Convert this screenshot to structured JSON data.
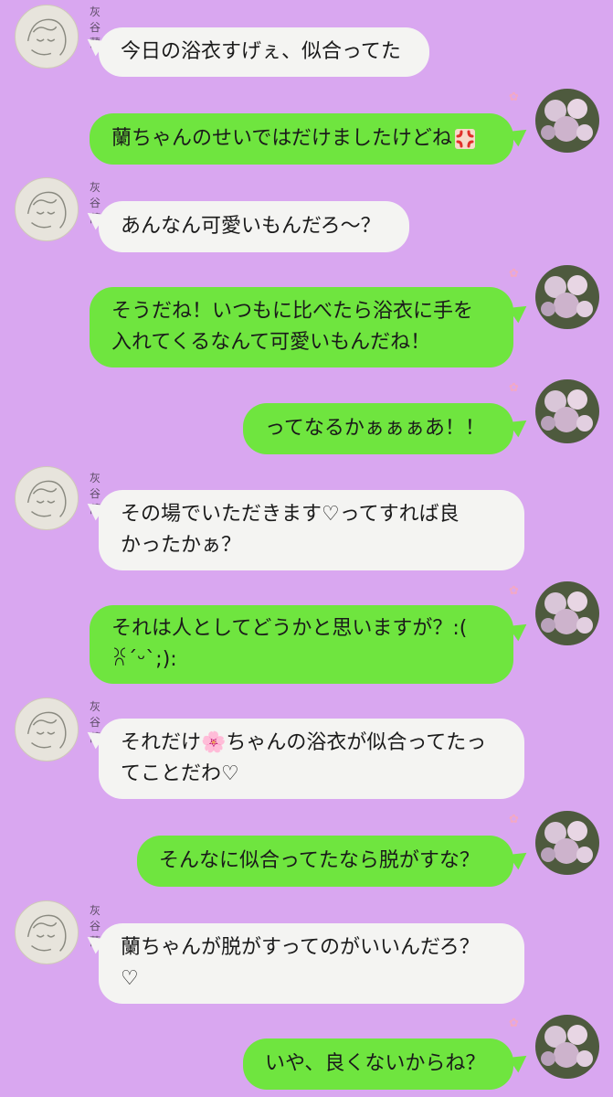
{
  "chat": {
    "contact_name": "灰谷 蘭",
    "colors": {
      "background": "#d9a7f0",
      "incoming_bubble": "#f4f4f2",
      "outgoing_bubble": "#6fe53f"
    },
    "messages": [
      {
        "side": "in",
        "sender": "灰谷 蘭",
        "text": "今日の浴衣すげぇ、似合ってた"
      },
      {
        "side": "out",
        "flower": "✿",
        "text": "蘭ちゃんのせいではだけましたけどね",
        "emoji": "anger-symbol-icon"
      },
      {
        "side": "in",
        "sender": "灰谷 蘭",
        "text": "あんなん可愛いもんだろ〜？"
      },
      {
        "side": "out",
        "flower": "✿",
        "text": "そうだね！いつもに比べたら浴衣に手を\n入れてくるなんて可愛いもんだね！"
      },
      {
        "side": "out",
        "flower": "✿",
        "text": "ってなるかぁぁぁあ！！"
      },
      {
        "side": "in",
        "sender": "灰谷 蘭",
        "text": "その場でいただきます♡ってすれば良\nかったかぁ？"
      },
      {
        "side": "out",
        "flower": "✿",
        "text": "それは人としてどうかと思いますが？:(\nꐦ´ᵕ`;):"
      },
      {
        "side": "in",
        "sender": "灰谷 蘭",
        "text": "それだけ🌸ちゃんの浴衣が似合ってたっ\nてことだわ♡"
      },
      {
        "side": "out",
        "flower": "✿",
        "text": "そんなに似合ってたなら脱がすな？"
      },
      {
        "side": "in",
        "sender": "灰谷 蘭",
        "text": "蘭ちゃんが脱がすってのがいいんだろ？\n♡"
      },
      {
        "side": "out",
        "flower": "✿",
        "text": "いや、良くないからね？"
      }
    ]
  }
}
